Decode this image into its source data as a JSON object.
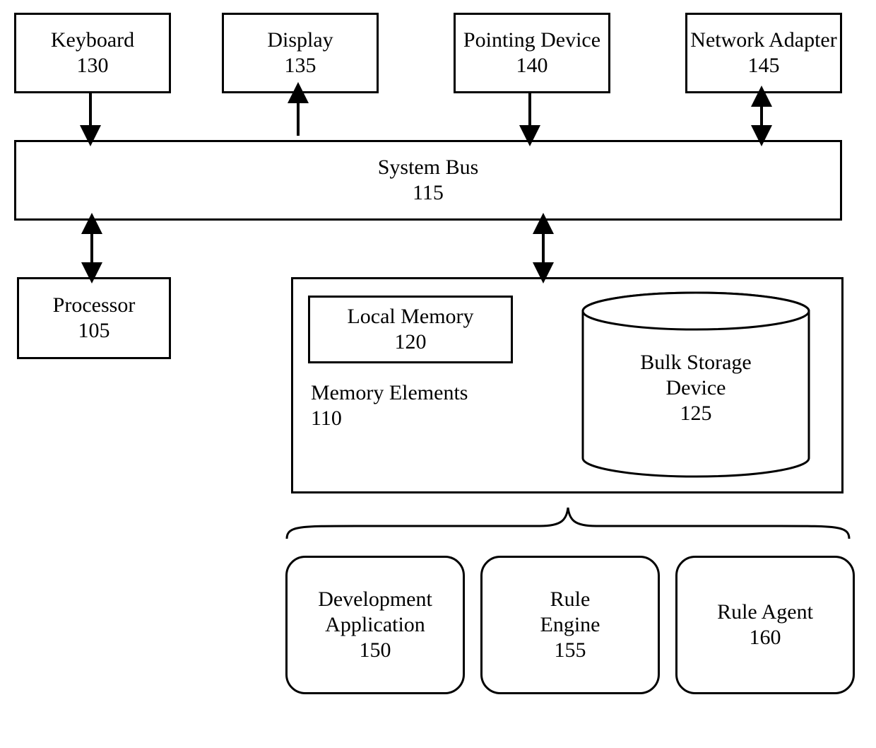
{
  "peripherals": {
    "keyboard": {
      "label": "Keyboard",
      "num": "130"
    },
    "display": {
      "label": "Display",
      "num": "135"
    },
    "pointing": {
      "label": "Pointing Device",
      "num": "140"
    },
    "network": {
      "label": "Network Adapter",
      "num": "145"
    }
  },
  "bus": {
    "label": "System Bus",
    "num": "115"
  },
  "processor": {
    "label": "Processor",
    "num": "105"
  },
  "memory": {
    "elements": {
      "label": "Memory Elements",
      "num": "110"
    },
    "local": {
      "label": "Local Memory",
      "num": "120"
    },
    "bulk": {
      "line1": "Bulk Storage",
      "line2": "Device",
      "num": "125"
    }
  },
  "software": {
    "dev": {
      "line1": "Development",
      "line2": "Application",
      "num": "150"
    },
    "engine": {
      "line1": "Rule",
      "line2": "Engine",
      "num": "155"
    },
    "agent": {
      "label": "Rule Agent",
      "num": "160"
    }
  }
}
